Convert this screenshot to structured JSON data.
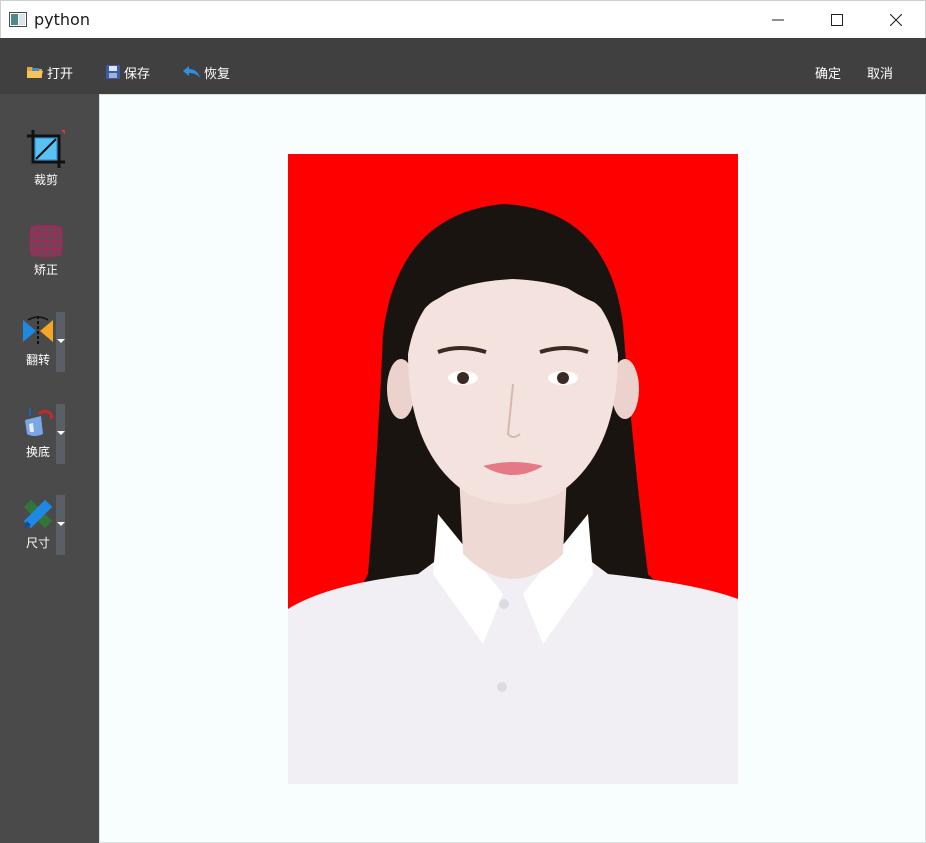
{
  "window": {
    "title": "python"
  },
  "toolbar": {
    "open_label": "打开",
    "save_label": "保存",
    "restore_label": "恢复",
    "confirm_label": "确定",
    "cancel_label": "取消"
  },
  "sidebar": {
    "items": [
      {
        "label": "裁剪",
        "icon": "crop-icon"
      },
      {
        "label": "矫正",
        "icon": "grid-warp-icon"
      },
      {
        "label": "翻转",
        "icon": "flip-icon"
      },
      {
        "label": "换底",
        "icon": "paint-bucket-icon"
      },
      {
        "label": "尺寸",
        "icon": "pencil-ruler-icon"
      }
    ]
  },
  "canvas": {
    "photo": {
      "background_color": "#ff0000",
      "subject": "id-photo-portrait"
    }
  },
  "colors": {
    "toolbar_bg": "#404040",
    "sidebar_bg": "#4a4a4a",
    "canvas_bg": "#f8fefe",
    "accent_blue": "#1e88e5"
  }
}
